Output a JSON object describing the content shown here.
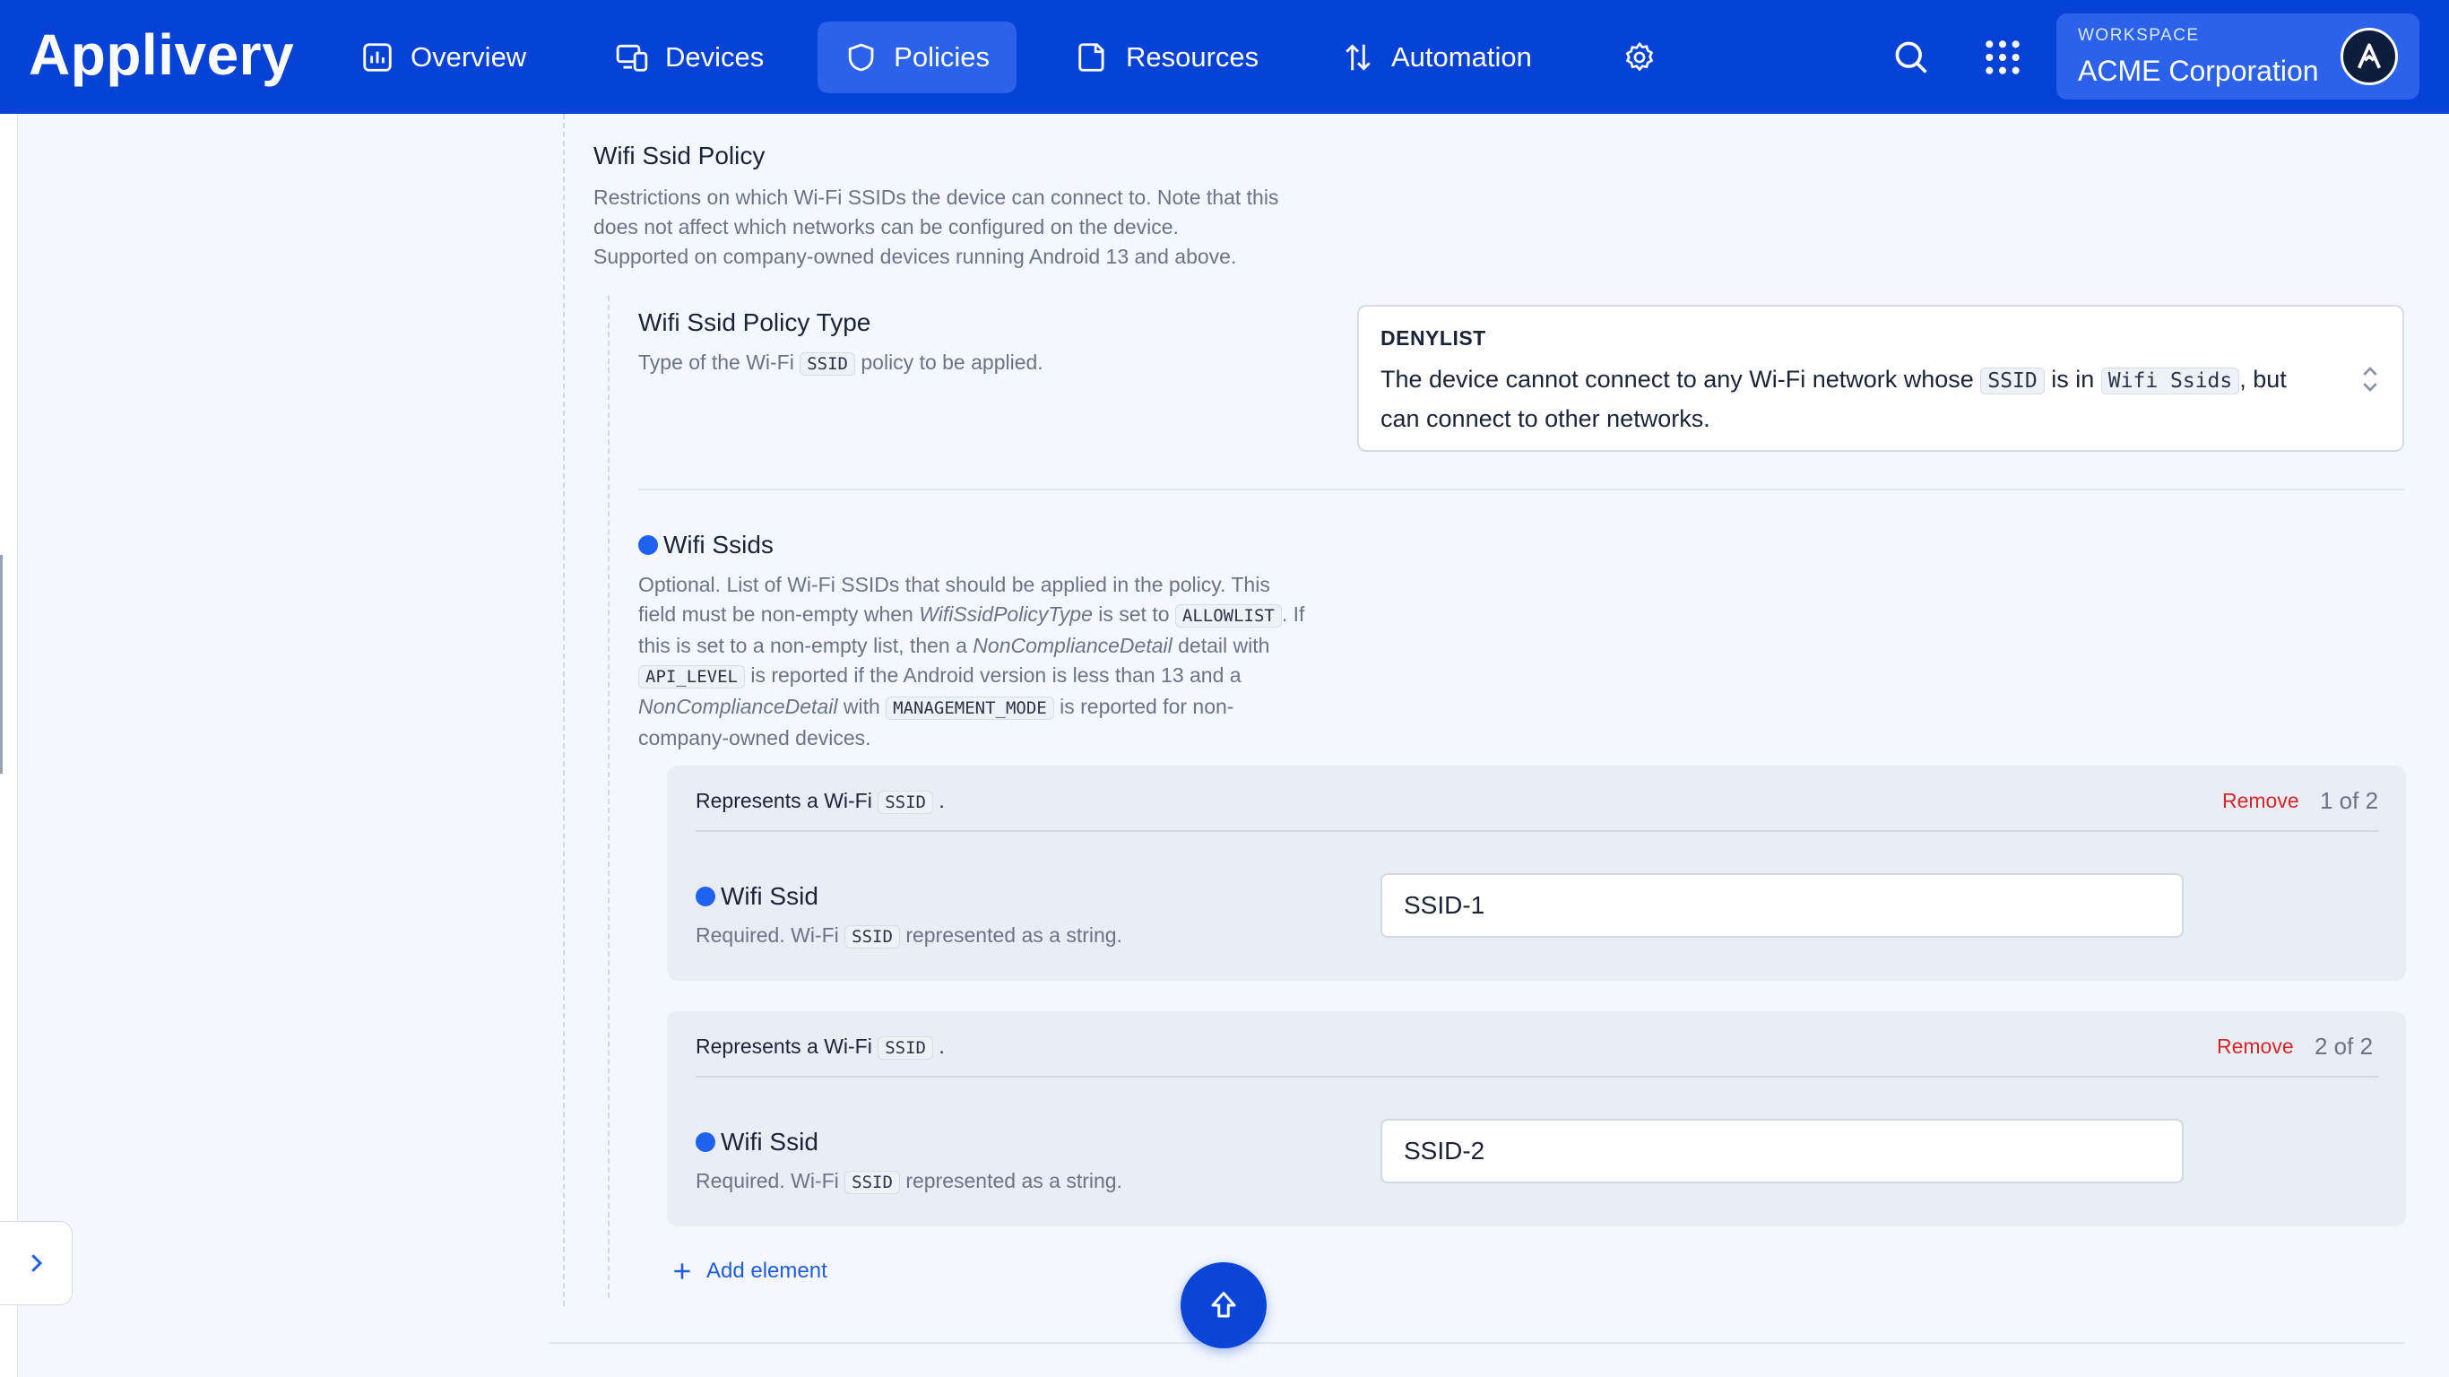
{
  "app": {
    "logo_text": "Applivery"
  },
  "nav": {
    "items": [
      {
        "label": "Overview",
        "icon": "chart-icon"
      },
      {
        "label": "Devices",
        "icon": "devices-icon"
      },
      {
        "label": "Policies",
        "icon": "shield-icon",
        "active": true
      },
      {
        "label": "Resources",
        "icon": "folder-icon"
      },
      {
        "label": "Automation",
        "icon": "automation-icon"
      }
    ],
    "settings_icon": "gear-icon"
  },
  "header_actions": {
    "search_icon": "search-icon",
    "apps_icon": "grid-icon"
  },
  "workspace": {
    "label": "WORKSPACE",
    "name": "ACME Corporation",
    "avatar_icon": "applivery-avatar-icon"
  },
  "section": {
    "title": "Wifi Ssid Policy",
    "description_lines": [
      "Restrictions on which Wi-Fi SSIDs the device can connect to. Note that this",
      "does not affect which networks can be configured on the device.",
      "Supported on company-owned devices running Android 13 and above."
    ]
  },
  "policy_type": {
    "title": "Wifi Ssid Policy Type",
    "desc_before": "Type of the Wi-Fi",
    "desc_code": "SSID",
    "desc_after": "policy to be applied.",
    "selected_value": "DENYLIST",
    "selected_text_1": "The device cannot connect to any Wi-Fi network whose",
    "selected_code_1": "SSID",
    "selected_text_2": "is in",
    "selected_code_2": "Wifi Ssids",
    "selected_text_3": ", but",
    "selected_text_4": "can connect to other networks."
  },
  "wifi_ssids": {
    "title": "Wifi Ssids",
    "desc_l1": "Optional. List of Wi-Fi SSIDs that should be applied in the policy. This",
    "desc_l2a": "field must be non-empty when",
    "desc_l2_em": "WifiSsidPolicyType",
    "desc_l2b": "is set to",
    "desc_l2_code": "ALLOWLIST",
    "desc_l2c": ". If",
    "desc_l3a": "this is set to a non-empty list, then a",
    "desc_l3_em": "NonComplianceDetail",
    "desc_l3b": "detail with",
    "desc_l4_code": "API_LEVEL",
    "desc_l4a": "is reported if the Android version is less than 13 and a",
    "desc_l5_em": "NonComplianceDetail",
    "desc_l5a": "with",
    "desc_l5_code": "MANAGEMENT_MODE",
    "desc_l5b": "is reported for non-",
    "desc_l6": "company-owned devices.",
    "elements": [
      {
        "head_before": "Represents a Wi-Fi",
        "head_code": "SSID",
        "head_after": ".",
        "remove_label": "Remove",
        "counter": "1 of 2",
        "field_label": "Wifi Ssid",
        "field_desc_before": "Required. Wi-Fi",
        "field_desc_code": "SSID",
        "field_desc_after": "represented as a string.",
        "value": "SSID-1"
      },
      {
        "head_before": "Represents a Wi-Fi",
        "head_code": "SSID",
        "head_after": ".",
        "remove_label": "Remove",
        "counter": "2 of 2",
        "field_label": "Wifi Ssid",
        "field_desc_before": "Required. Wi-Fi",
        "field_desc_code": "SSID",
        "field_desc_after": "represented as a string.",
        "value": "SSID-2"
      }
    ],
    "add_label": "Add element"
  },
  "colors": {
    "brand": "#0742d6",
    "active_nav": "#2c62ea",
    "danger": "#d4262b",
    "link": "#1f5ce0"
  }
}
